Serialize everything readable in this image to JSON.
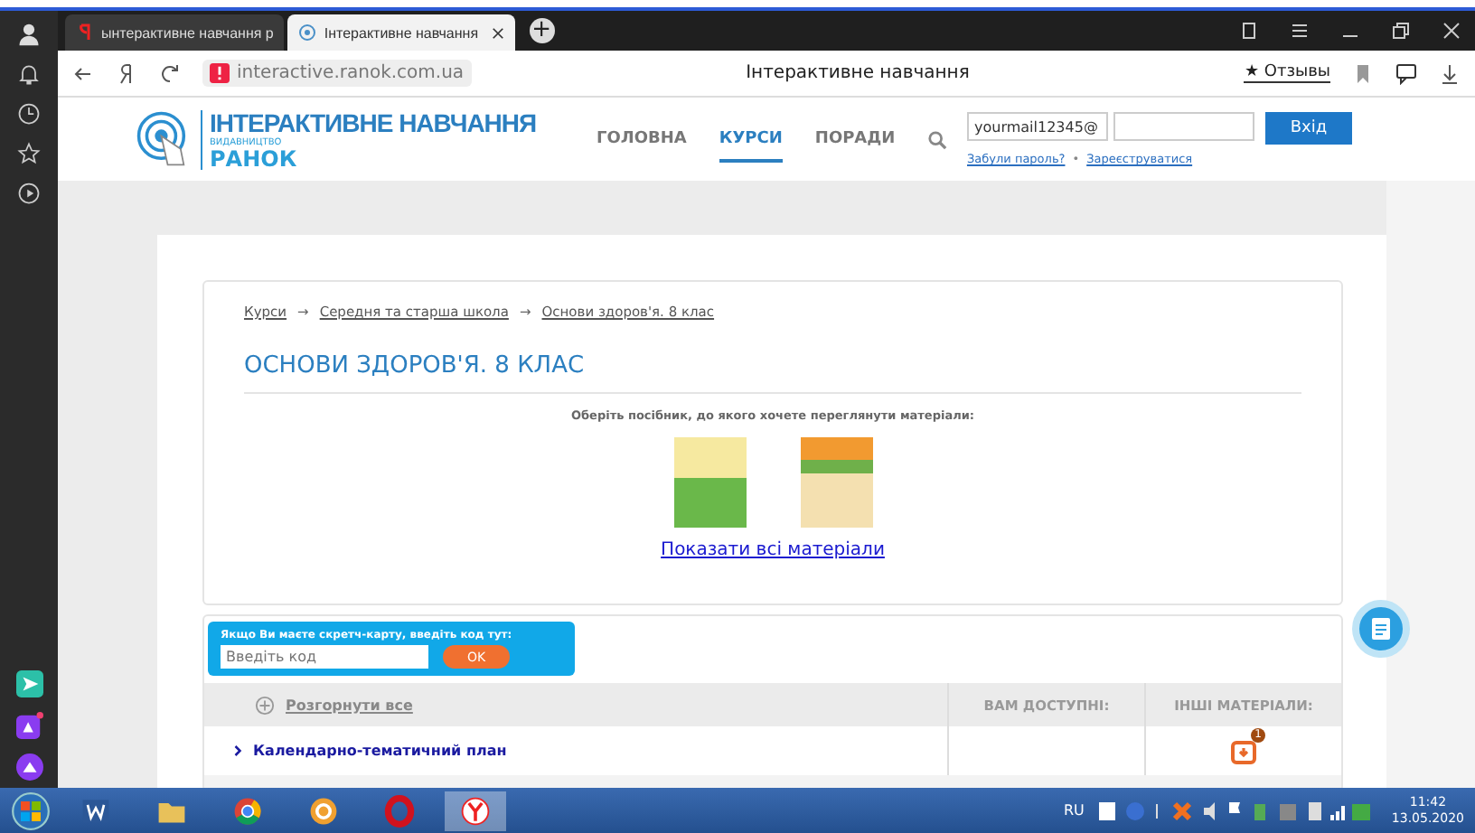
{
  "browser": {
    "tabs": [
      {
        "title": "ынтерактивне навчання р",
        "selected": false
      },
      {
        "title": "Інтерактивне навчання",
        "selected": true
      }
    ],
    "new_tab": "+",
    "address": "interactive.ranok.com.ua",
    "page_title": "Інтерактивне навчання",
    "reviews_button": "★ Отзывы"
  },
  "site": {
    "logo_title": "ІНТЕРАКТИВНЕ НАВЧАННЯ",
    "logo_sub": "ВИДАВНИЦТВО",
    "logo_brand": "РАНОК",
    "nav": [
      {
        "label": "ГОЛОВНА",
        "selected": false
      },
      {
        "label": "КУРСИ",
        "selected": true
      },
      {
        "label": "ПОРАДИ",
        "selected": false
      }
    ],
    "login": {
      "email": "yourmail12345@",
      "submit": "Вхід",
      "forgot": "Забули пароль?",
      "separator": "•",
      "register": "Зареєструватися"
    }
  },
  "breadcrumbs": [
    "Курси",
    "Середня та старша школа",
    "Основи здоров'я. 8 клас"
  ],
  "breadcrumb_separator": "→",
  "title": "ОСНОВИ ЗДОРОВ'Я. 8 КЛАС",
  "prompt": "Оберіть посібник, до якого хочете переглянути матеріали:",
  "show_all": "Показати всі матеріали",
  "scratch": {
    "label": "Якщо Ви маєте скретч-карту, введіть код тут:",
    "placeholder": "Введіть код",
    "button": "OK"
  },
  "table": {
    "expand_all": "Розгорнути все",
    "columns": [
      "ВАМ ДОСТУПНІ:",
      "ІНШІ МАТЕРІАЛИ:"
    ],
    "rows": [
      {
        "title": "Календарно-тематичний план",
        "badge": "1"
      }
    ]
  },
  "taskbar": {
    "language": "RU",
    "time": "11:42",
    "date": "13.05.2020"
  }
}
